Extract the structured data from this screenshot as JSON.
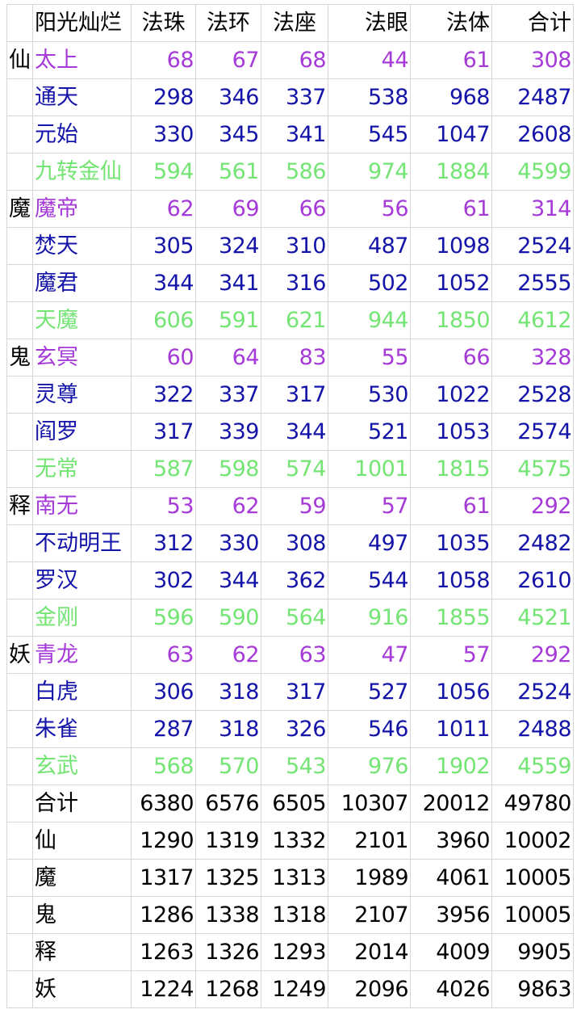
{
  "header": [
    "阳光灿烂",
    "法珠",
    "法环",
    "法座",
    "法眼",
    "法体",
    "合计"
  ],
  "colors": {
    "purple": "#a53ad8",
    "blue": "#1414a8",
    "green": "#74e474",
    "black": "#000000"
  },
  "groups": [
    {
      "name": "仙",
      "rows": [
        {
          "name": "太上",
          "color": "purple",
          "values": [
            "68",
            "67",
            "68",
            "44",
            "61",
            "308"
          ]
        },
        {
          "name": "通天",
          "color": "blue",
          "values": [
            "298",
            "346",
            "337",
            "538",
            "968",
            "2487"
          ]
        },
        {
          "name": "元始",
          "color": "blue",
          "values": [
            "330",
            "345",
            "341",
            "545",
            "1047",
            "2608"
          ]
        },
        {
          "name": "九转金仙",
          "color": "green",
          "values": [
            "594",
            "561",
            "586",
            "974",
            "1884",
            "4599"
          ]
        }
      ]
    },
    {
      "name": "魔",
      "rows": [
        {
          "name": "魔帝",
          "color": "purple",
          "values": [
            "62",
            "69",
            "66",
            "56",
            "61",
            "314"
          ]
        },
        {
          "name": "焚天",
          "color": "blue",
          "values": [
            "305",
            "324",
            "310",
            "487",
            "1098",
            "2524"
          ]
        },
        {
          "name": "魔君",
          "color": "blue",
          "values": [
            "344",
            "341",
            "316",
            "502",
            "1052",
            "2555"
          ]
        },
        {
          "name": "天魔",
          "color": "green",
          "values": [
            "606",
            "591",
            "621",
            "944",
            "1850",
            "4612"
          ]
        }
      ]
    },
    {
      "name": "鬼",
      "rows": [
        {
          "name": "玄冥",
          "color": "purple",
          "values": [
            "60",
            "64",
            "83",
            "55",
            "66",
            "328"
          ]
        },
        {
          "name": "灵尊",
          "color": "blue",
          "values": [
            "322",
            "337",
            "317",
            "530",
            "1022",
            "2528"
          ]
        },
        {
          "name": "阎罗",
          "color": "blue",
          "values": [
            "317",
            "339",
            "344",
            "521",
            "1053",
            "2574"
          ]
        },
        {
          "name": "无常",
          "color": "green",
          "values": [
            "587",
            "598",
            "574",
            "1001",
            "1815",
            "4575"
          ]
        }
      ]
    },
    {
      "name": "释",
      "rows": [
        {
          "name": "南无",
          "color": "purple",
          "values": [
            "53",
            "62",
            "59",
            "57",
            "61",
            "292"
          ]
        },
        {
          "name": "不动明王",
          "color": "blue",
          "values": [
            "312",
            "330",
            "308",
            "497",
            "1035",
            "2482"
          ]
        },
        {
          "name": "罗汉",
          "color": "blue",
          "values": [
            "302",
            "344",
            "362",
            "544",
            "1058",
            "2610"
          ]
        },
        {
          "name": "金刚",
          "color": "green",
          "values": [
            "596",
            "590",
            "564",
            "916",
            "1855",
            "4521"
          ]
        }
      ]
    },
    {
      "name": "妖",
      "rows": [
        {
          "name": "青龙",
          "color": "purple",
          "values": [
            "63",
            "62",
            "63",
            "47",
            "57",
            "292"
          ]
        },
        {
          "name": "白虎",
          "color": "blue",
          "values": [
            "306",
            "318",
            "317",
            "527",
            "1056",
            "2524"
          ]
        },
        {
          "name": "朱雀",
          "color": "blue",
          "values": [
            "287",
            "318",
            "326",
            "546",
            "1011",
            "2488"
          ]
        },
        {
          "name": "玄武",
          "color": "green",
          "values": [
            "568",
            "570",
            "543",
            "976",
            "1902",
            "4559"
          ]
        }
      ]
    }
  ],
  "totals": [
    {
      "name": "合计",
      "values": [
        "6380",
        "6576",
        "6505",
        "10307",
        "20012",
        "49780"
      ]
    },
    {
      "name": "仙",
      "values": [
        "1290",
        "1319",
        "1332",
        "2101",
        "3960",
        "10002"
      ]
    },
    {
      "name": "魔",
      "values": [
        "1317",
        "1325",
        "1313",
        "1989",
        "4061",
        "10005"
      ]
    },
    {
      "name": "鬼",
      "values": [
        "1286",
        "1338",
        "1318",
        "2107",
        "3956",
        "10005"
      ]
    },
    {
      "name": "释",
      "values": [
        "1263",
        "1326",
        "1293",
        "2014",
        "4009",
        "9905"
      ]
    },
    {
      "name": "妖",
      "values": [
        "1224",
        "1268",
        "1249",
        "2096",
        "4026",
        "9863"
      ]
    }
  ]
}
